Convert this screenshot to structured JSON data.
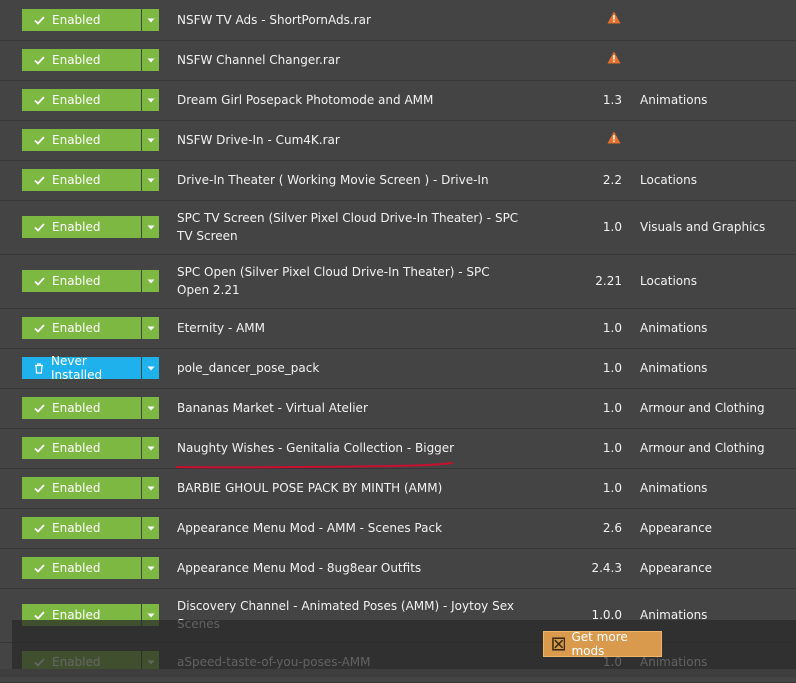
{
  "mods": [
    {
      "status": "Enabled",
      "status_type": "enabled",
      "name": "NSFW TV Ads - ShortPornAds.rar",
      "version": "",
      "warning": true,
      "category": ""
    },
    {
      "status": "Enabled",
      "status_type": "enabled",
      "name": "NSFW Channel Changer.rar",
      "version": "",
      "warning": true,
      "category": ""
    },
    {
      "status": "Enabled",
      "status_type": "enabled",
      "name": "Dream Girl Posepack Photomode and AMM",
      "version": "1.3",
      "warning": false,
      "category": "Animations"
    },
    {
      "status": "Enabled",
      "status_type": "enabled",
      "name": "NSFW Drive-In - Cum4K.rar",
      "version": "",
      "warning": true,
      "category": ""
    },
    {
      "status": "Enabled",
      "status_type": "enabled",
      "name": "Drive-In Theater ( Working Movie Screen ) - Drive-In",
      "version": "2.2",
      "warning": false,
      "category": "Locations"
    },
    {
      "status": "Enabled",
      "status_type": "enabled",
      "name": "SPC TV Screen (Silver Pixel Cloud Drive-In Theater) - SPC TV Screen",
      "version": "1.0",
      "warning": false,
      "category": "Visuals and Graphics"
    },
    {
      "status": "Enabled",
      "status_type": "enabled",
      "name": "SPC Open (Silver Pixel Cloud Drive-In Theater) - SPC Open 2.21",
      "version": "2.21",
      "warning": false,
      "category": "Locations"
    },
    {
      "status": "Enabled",
      "status_type": "enabled",
      "name": "Eternity - AMM",
      "version": "1.0",
      "warning": false,
      "category": "Animations"
    },
    {
      "status": "Never Installed",
      "status_type": "never",
      "name": "pole_dancer_pose_pack",
      "version": "1.0",
      "warning": false,
      "category": "Animations"
    },
    {
      "status": "Enabled",
      "status_type": "enabled",
      "name": "Bananas Market - Virtual Atelier",
      "version": "1.0",
      "warning": false,
      "category": "Armour and Clothing"
    },
    {
      "status": "Enabled",
      "status_type": "enabled",
      "name": "Naughty Wishes - Genitalia Collection - Bigger",
      "version": "1.0",
      "warning": false,
      "category": "Armour and Clothing"
    },
    {
      "status": "Enabled",
      "status_type": "enabled",
      "name": "BARBIE GHOUL POSE PACK BY MINTH (AMM)",
      "version": "1.0",
      "warning": false,
      "category": "Animations"
    },
    {
      "status": "Enabled",
      "status_type": "enabled",
      "name": "Appearance Menu Mod - AMM - Scenes Pack",
      "version": "2.6",
      "warning": false,
      "category": "Appearance"
    },
    {
      "status": "Enabled",
      "status_type": "enabled",
      "name": "Appearance Menu Mod - 8ug8ear Outfits",
      "version": "2.4.3",
      "warning": false,
      "category": "Appearance"
    },
    {
      "status": "Enabled",
      "status_type": "enabled",
      "name": "Discovery Channel - Animated Poses (AMM) - Joytoy Sex Scenes",
      "version": "1.0.0",
      "warning": false,
      "category": "Animations"
    },
    {
      "status": "Enabled",
      "status_type": "enabled",
      "name": "aSpeed-taste-of-you-poses-AMM",
      "version": "1.0",
      "warning": false,
      "category": "Animations"
    }
  ],
  "footer": {
    "get_more_mods_label": "Get more mods"
  },
  "colors": {
    "enabled": "#7db842",
    "never_installed": "#1fb1ec",
    "warning": "#e8702a",
    "accent_button": "#d99a4e",
    "annotation": "#c8102e"
  }
}
